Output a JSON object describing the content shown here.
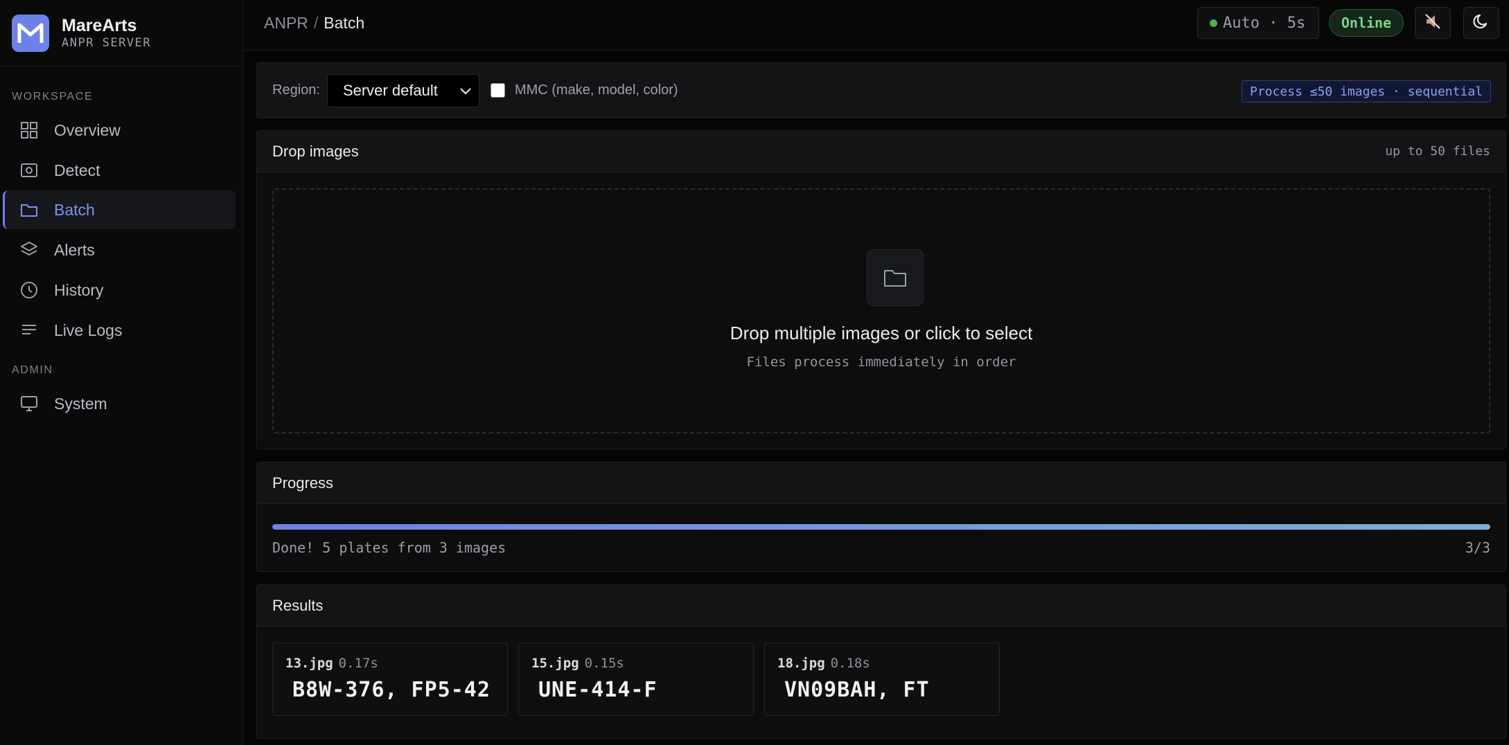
{
  "brand": {
    "name": "MareArts",
    "subtitle": "ANPR SERVER"
  },
  "sidebar": {
    "sections": [
      "WORKSPACE",
      "ADMIN"
    ],
    "items": [
      {
        "label": "Overview",
        "icon": "grid-icon"
      },
      {
        "label": "Detect",
        "icon": "camera-icon"
      },
      {
        "label": "Batch",
        "icon": "folder-icon",
        "active": true
      },
      {
        "label": "Alerts",
        "icon": "layers-icon"
      },
      {
        "label": "History",
        "icon": "clock-icon"
      },
      {
        "label": "Live Logs",
        "icon": "lines-icon"
      },
      {
        "label": "System",
        "icon": "monitor-icon"
      }
    ]
  },
  "header": {
    "breadcrumb": [
      "ANPR",
      "Batch"
    ],
    "separator": "/",
    "auto_refresh": "Auto · 5s",
    "status": "Online"
  },
  "controls": {
    "region_label": "Region:",
    "region_value": "Server default",
    "mmc_label": "MMC (make, model, color)",
    "mmc_checked": false,
    "process_badge": "Process ≤50 images · sequential"
  },
  "drop": {
    "title": "Drop images",
    "meta": "up to 50 files",
    "prompt": "Drop multiple images or click to select",
    "subtext": "Files process immediately in order"
  },
  "progress": {
    "title": "Progress",
    "percent": 100,
    "message": "Done! 5 plates from 3 images",
    "count": "3/3"
  },
  "results": {
    "title": "Results",
    "items": [
      {
        "file": "13.jpg",
        "time": "0.17s",
        "plates": "B8W-376, FP5-42"
      },
      {
        "file": "15.jpg",
        "time": "0.15s",
        "plates": "UNE-414-F"
      },
      {
        "file": "18.jpg",
        "time": "0.18s",
        "plates": "VN09BAH, FT"
      }
    ]
  },
  "colors": {
    "accent": "#6d82e8",
    "online": "#7bd389",
    "background": "#050505"
  }
}
